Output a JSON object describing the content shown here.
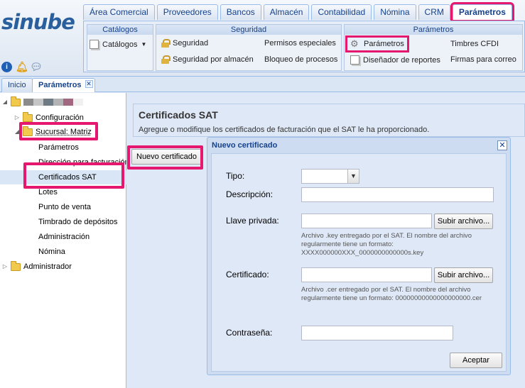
{
  "app": {
    "logo": "sinube"
  },
  "module_tabs": [
    "Área Comercial",
    "Proveedores",
    "Bancos",
    "Almacén",
    "Contabilidad",
    "Nómina",
    "CRM",
    "Parámetros"
  ],
  "ribbon": {
    "catalogos": {
      "title": "Catálogos",
      "item": "Catálogos"
    },
    "seguridad": {
      "title": "Seguridad",
      "items": [
        "Seguridad",
        "Seguridad por almacén",
        "Permisos especiales",
        "Bloqueo de procesos"
      ]
    },
    "parametros": {
      "title": "Parámetros",
      "items": [
        "Parámetros",
        "Diseñador de reportes",
        "Timbres CFDI",
        "Firmas para correo"
      ]
    }
  },
  "page_tabs": [
    "Inicio",
    "Parámetros"
  ],
  "tree": {
    "configuracion": "Configuración",
    "sucursal": "Sucursal: Matriz",
    "children": [
      "Parámetros",
      "Dirección para facturación",
      "Certificados SAT",
      "Lotes",
      "Punto de venta",
      "Timbrado de depósitos",
      "Administración",
      "Nómina"
    ],
    "administrador": "Administrador",
    "redacted_colors": [
      "#8b8b8b",
      "#c6c6c6",
      "#6e7a84",
      "#b3b3b3",
      "#a2687f",
      "#ffffff"
    ]
  },
  "main": {
    "title": "Certificados SAT",
    "subtitle": "Agregue o modifique los certificados de facturación que el SAT le ha proporcionado.",
    "new_button": "Nuevo certificado"
  },
  "modal": {
    "title": "Nuevo certificado",
    "tipo_label": "Tipo:",
    "desc_label": "Descripción:",
    "llave_label": "Llave privada:",
    "llave_button": "Subir archivo...",
    "llave_help": "Archivo .key entregado por el SAT. El nombre del archivo regularmente tiene un formato: XXXX000000XXX_0000000000000s.key",
    "cert_label": "Certificado:",
    "cert_button": "Subir archivo...",
    "cert_help": "Archivo .cer entregado por el SAT. El nombre del archivo regularmente tiene un formato: 00000000000000000000.cer",
    "pass_label": "Contraseña:",
    "accept_button": "Aceptar"
  },
  "colors": {
    "highlight": "#e5176f",
    "brand": "#2a5f9e",
    "accent": "#15428b"
  }
}
